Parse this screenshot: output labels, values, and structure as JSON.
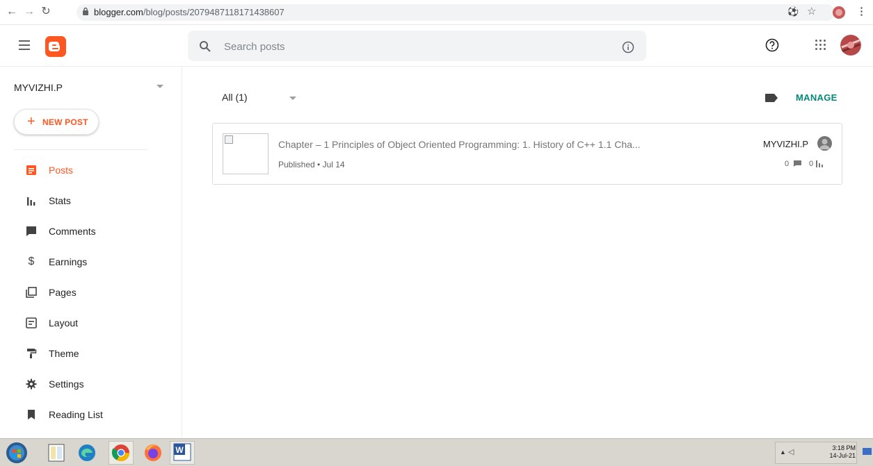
{
  "browser": {
    "url_host": "blogger.com",
    "url_path": "/blog/posts/2079487118171438607",
    "icons": [
      "back-arrow-icon",
      "forward-arrow-icon",
      "reload-icon",
      "lock-icon",
      "key-icon",
      "star-icon",
      "profile-avatar-icon",
      "menu-kebab-icon"
    ]
  },
  "header": {
    "search": {
      "placeholder": "Search posts"
    },
    "icons": [
      "hamburger-menu-icon",
      "blogger-logo",
      "search-icon",
      "info-icon",
      "help-icon",
      "apps-grid-icon",
      "user-avatar"
    ]
  },
  "sidebar": {
    "blog_name": "MYVIZHI.P",
    "new_post_label": "NEW POST",
    "items": [
      {
        "label": "Posts",
        "icon": "posts-icon",
        "active": true
      },
      {
        "label": "Stats",
        "icon": "stats-icon",
        "active": false
      },
      {
        "label": "Comments",
        "icon": "comments-icon",
        "active": false
      },
      {
        "label": "Earnings",
        "icon": "dollar-icon",
        "active": false
      },
      {
        "label": "Pages",
        "icon": "pages-icon",
        "active": false
      },
      {
        "label": "Layout",
        "icon": "layout-icon",
        "active": false
      },
      {
        "label": "Theme",
        "icon": "paint-roller-icon",
        "active": false
      },
      {
        "label": "Settings",
        "icon": "gear-icon",
        "active": false
      },
      {
        "label": "Reading List",
        "icon": "bookmark-icon",
        "active": false
      }
    ]
  },
  "main": {
    "filter_label": "All (1)",
    "manage_label": "MANAGE",
    "posts": [
      {
        "title": "Chapter – 1 Principles of Object Oriented Programming: 1. History of C++ 1.1 Cha...",
        "status": "Published • Jul 14",
        "author": "MYVIZHI.P",
        "comments": "0",
        "views": "0"
      }
    ]
  },
  "taskbar": {
    "apps": [
      "start-orb",
      "tally-erp9-icon",
      "edge-icon",
      "chrome-icon",
      "firefox-icon",
      "word-icon"
    ],
    "time": "3:18 PM",
    "date": "14-Jul-21"
  },
  "colors": {
    "accent": "#ff5722",
    "manage": "#00897b",
    "search_bg": "#f1f3f4"
  }
}
